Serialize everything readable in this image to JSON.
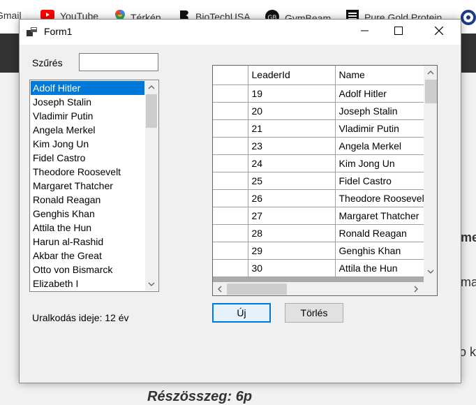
{
  "browser": {
    "bookmarks": [
      {
        "label": "Gmail",
        "icon": "gmail-icon"
      },
      {
        "label": "YouTube",
        "icon": "youtube-icon"
      },
      {
        "label": "Térkép",
        "icon": "maps-icon"
      },
      {
        "label": "BioTechUSA",
        "icon": "biotech-icon"
      },
      {
        "label": "GymBeam",
        "icon": "gymbeam-icon"
      },
      {
        "label": "Pure Gold Protein",
        "icon": "puregold-icon"
      }
    ],
    "page_fragments": [
      "me",
      "maz",
      "o k"
    ],
    "page_footer": "Részösszeg: 6p"
  },
  "window": {
    "title": "Form1",
    "filter_label": "Szűrés",
    "filter_value": "",
    "reign_label": "Uralkodás ideje: 12 év",
    "list_items": [
      "Adolf Hitler",
      "Joseph Stalin",
      "Vladimir Putin",
      "Angela Merkel",
      "Kim Jong Un",
      "Fidel Castro",
      "Theodore Roosevelt",
      "Margaret Thatcher",
      "Ronald Reagan",
      "Genghis Khan",
      "Attila the Hun",
      "Harun al-Rashid",
      "Akbar the Great",
      "Otto von Bismarck",
      "Elizabeth I"
    ],
    "selected_index": 0,
    "grid": {
      "columns": [
        "LeaderId",
        "Name"
      ],
      "rows": [
        [
          "19",
          "Adolf Hitler"
        ],
        [
          "20",
          "Joseph Stalin"
        ],
        [
          "21",
          "Vladimir Putin"
        ],
        [
          "23",
          "Angela Merkel"
        ],
        [
          "24",
          "Kim Jong Un"
        ],
        [
          "25",
          "Fidel Castro"
        ],
        [
          "26",
          "Theodore Roosevelt"
        ],
        [
          "27",
          "Margaret Thatcher"
        ],
        [
          "28",
          "Ronald Reagan"
        ],
        [
          "29",
          "Genghis Khan"
        ],
        [
          "30",
          "Attila the Hun"
        ]
      ]
    },
    "new_button": "Új",
    "delete_button": "Törlés"
  },
  "colors": {
    "selection": "#0078d7",
    "window_bg": "#f0f0f0",
    "header_bar": "#333333"
  }
}
